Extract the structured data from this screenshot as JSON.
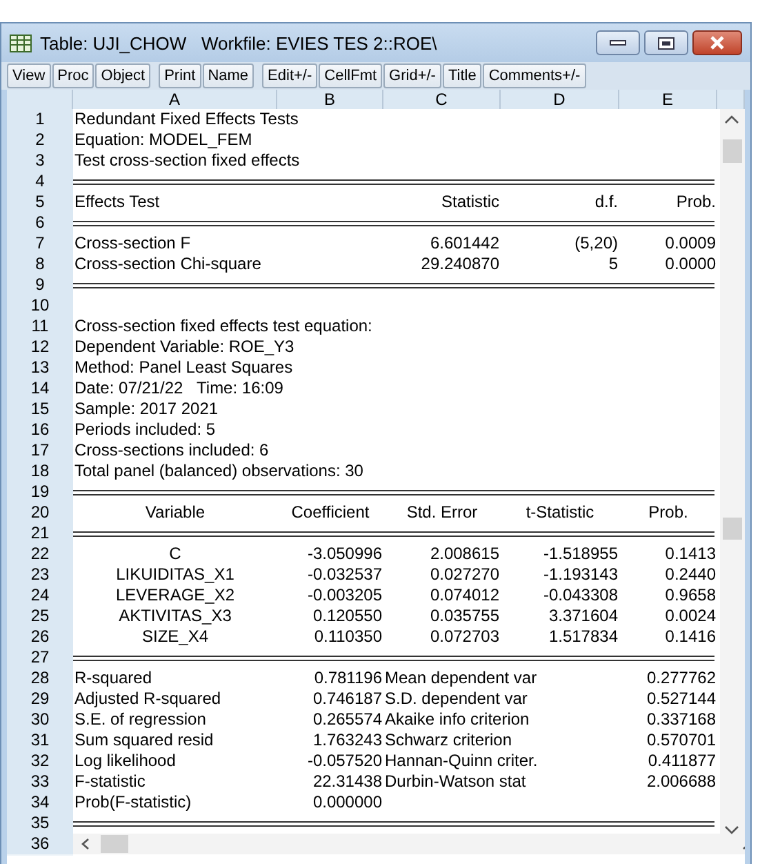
{
  "window": {
    "title": "Table: UJI_CHOW   Workfile: EVIES TES 2::ROE\\"
  },
  "toolbar_groups": [
    [
      "View",
      "Proc",
      "Object"
    ],
    [
      "Print",
      "Name"
    ],
    [
      "Edit+/-",
      "CellFmt",
      "Grid+/-",
      "Title",
      "Comments+/-"
    ]
  ],
  "columns": [
    "A",
    "B",
    "C",
    "D",
    "E"
  ],
  "rows": [
    {
      "number": "1",
      "kind": "text",
      "A": "Redundant Fixed Effects Tests"
    },
    {
      "number": "2",
      "kind": "text",
      "A": "Equation: MODEL_FEM"
    },
    {
      "number": "3",
      "kind": "text",
      "A": "Test cross-section fixed effects"
    },
    {
      "number": "4",
      "kind": "rule"
    },
    {
      "number": "5",
      "kind": "tests",
      "A": "Effects Test",
      "C": "Statistic",
      "D": "d.f.",
      "E": "Prob."
    },
    {
      "number": "6",
      "kind": "rule"
    },
    {
      "number": "7",
      "kind": "tests",
      "A": "Cross-section F",
      "C": "6.601442",
      "D": "(5,20)",
      "E": "0.0009"
    },
    {
      "number": "8",
      "kind": "tests",
      "A": "Cross-section Chi-square",
      "C": "29.240870",
      "D": "5",
      "E": "0.0000"
    },
    {
      "number": "9",
      "kind": "rule"
    },
    {
      "number": "10",
      "kind": "text"
    },
    {
      "number": "11",
      "kind": "text",
      "A": "Cross-section fixed effects test equation:"
    },
    {
      "number": "12",
      "kind": "text",
      "A": "Dependent Variable: ROE_Y3"
    },
    {
      "number": "13",
      "kind": "text",
      "A": "Method: Panel Least Squares"
    },
    {
      "number": "14",
      "kind": "text",
      "A": "Date: 07/21/22   Time: 16:09"
    },
    {
      "number": "15",
      "kind": "text",
      "A": "Sample: 2017 2021"
    },
    {
      "number": "16",
      "kind": "text",
      "A": "Periods included: 5"
    },
    {
      "number": "17",
      "kind": "text",
      "A": "Cross-sections included: 6"
    },
    {
      "number": "18",
      "kind": "text",
      "A": "Total panel (balanced) observations: 30"
    },
    {
      "number": "19",
      "kind": "rule"
    },
    {
      "number": "20",
      "kind": "header",
      "A": "Variable",
      "B": "Coefficient",
      "C": "Std. Error",
      "D": "t-Statistic",
      "E": "Prob."
    },
    {
      "number": "21",
      "kind": "rule"
    },
    {
      "number": "22",
      "kind": "coef",
      "A": "C",
      "B": "-3.050996",
      "C": "2.008615",
      "D": "-1.518955",
      "E": "0.1413"
    },
    {
      "number": "23",
      "kind": "coef",
      "A": "LIKUIDITAS_X1",
      "B": "-0.032537",
      "C": "0.027270",
      "D": "-1.193143",
      "E": "0.2440"
    },
    {
      "number": "24",
      "kind": "coef",
      "A": "LEVERAGE_X2",
      "B": "-0.003205",
      "C": "0.074012",
      "D": "-0.043308",
      "E": "0.9658"
    },
    {
      "number": "25",
      "kind": "coef",
      "A": "AKTIVITAS_X3",
      "B": "0.120550",
      "C": "0.035755",
      "D": "3.371604",
      "E": "0.0024"
    },
    {
      "number": "26",
      "kind": "coef",
      "A": "SIZE_X4",
      "B": "0.110350",
      "C": "0.072703",
      "D": "1.517834",
      "E": "0.1416"
    },
    {
      "number": "27",
      "kind": "rule"
    },
    {
      "number": "28",
      "kind": "stats",
      "A": "R-squared",
      "B": "0.781196",
      "C": "Mean dependent var",
      "E": "0.277762"
    },
    {
      "number": "29",
      "kind": "stats",
      "A": "Adjusted R-squared",
      "B": "0.746187",
      "C": "S.D. dependent var",
      "E": "0.527144"
    },
    {
      "number": "30",
      "kind": "stats",
      "A": "S.E. of regression",
      "B": "0.265574",
      "C": "Akaike info criterion",
      "E": "0.337168"
    },
    {
      "number": "31",
      "kind": "stats",
      "A": "Sum squared resid",
      "B": "1.763243",
      "C": "Schwarz criterion",
      "E": "0.570701"
    },
    {
      "number": "32",
      "kind": "stats",
      "A": "Log likelihood",
      "B": "-0.057520",
      "C": "Hannan-Quinn criter.",
      "E": "0.411877"
    },
    {
      "number": "33",
      "kind": "stats",
      "A": "F-statistic",
      "B": "22.31438",
      "C": "Durbin-Watson stat",
      "E": "2.006688"
    },
    {
      "number": "34",
      "kind": "stats",
      "A": "Prob(F-statistic)",
      "B": "0.000000"
    },
    {
      "number": "35",
      "kind": "rule"
    },
    {
      "number": "36",
      "kind": "scroll"
    }
  ]
}
